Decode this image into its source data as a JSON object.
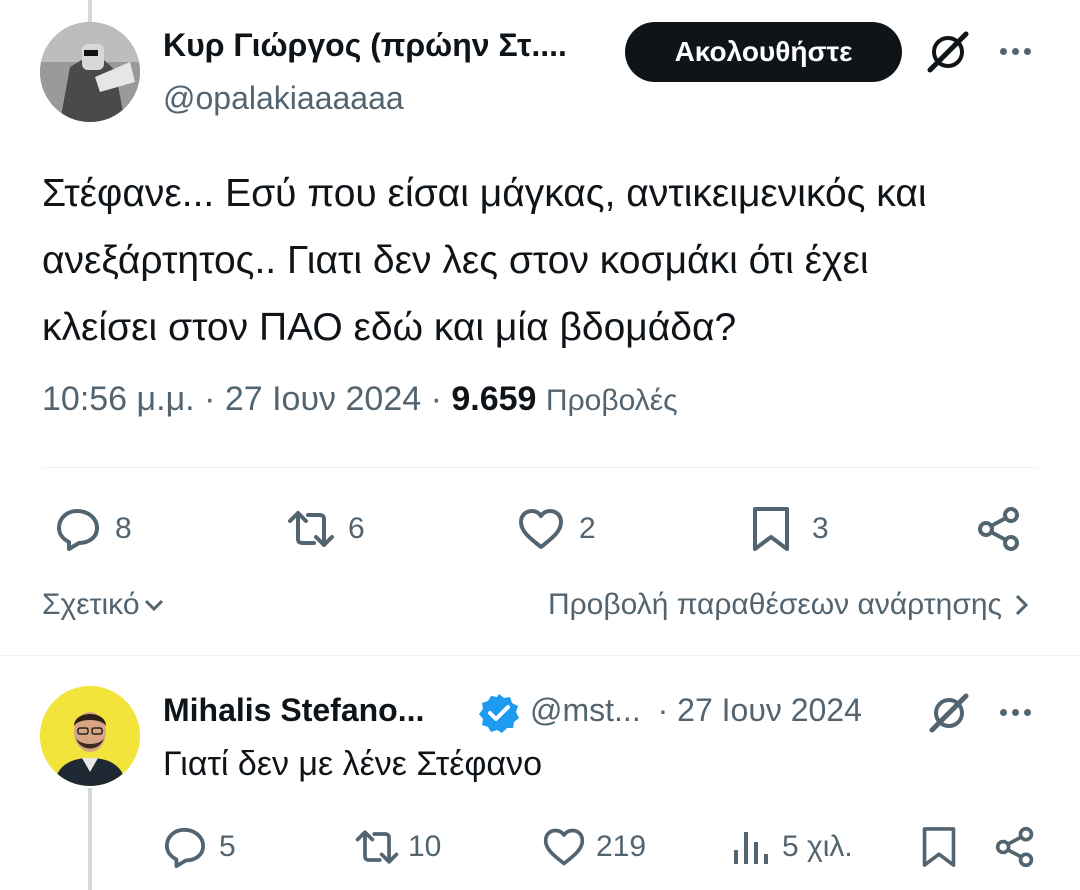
{
  "colors": {
    "text": "#0f1419",
    "secondary": "#536471",
    "verified": "#1d9bf0",
    "button_bg": "#0f1419"
  },
  "tweet": {
    "author_name": "Κυρ Γιώργος (πρώην Στ....",
    "author_handle": "@opalakiaaaaaa",
    "follow_label": "Ακολουθήστε",
    "text_lines": [
      "Στέφανε... Εσύ που είσαι μάγκας, αντικειμενικός και",
      "ανεξάρτητος.. Γιατι δεν λες στον κοσμάκι ότι έχει",
      "κλείσει στον ΠΑΟ εδώ και μία βδομάδα?"
    ],
    "time": "10:56 μ.μ.",
    "date": "27 Ιουν 2024",
    "separator": "·",
    "views_count": "9.659",
    "views_label": "Προβολές",
    "actions": {
      "replies": "8",
      "reposts": "6",
      "likes": "2",
      "bookmarks": "3"
    },
    "related_label": "Σχετικό",
    "quotes_label": "Προβολή παραθέσεων ανάρτησης"
  },
  "reply": {
    "author_name": "Mihalis Stefano...",
    "author_handle": "@mst...",
    "separator": "·",
    "date": "27 Ιουν 2024",
    "text": "Γιατί δεν με λένε Στέφανο",
    "actions": {
      "replies": "5",
      "reposts": "10",
      "likes": "219",
      "views": "5 χιλ."
    }
  },
  "icons": [
    "grok-icon",
    "more-icon",
    "reply-icon",
    "repost-icon",
    "like-icon",
    "bookmark-icon",
    "share-icon",
    "views-icon",
    "verified-badge-icon",
    "chevron-down-icon",
    "chevron-right-icon"
  ]
}
